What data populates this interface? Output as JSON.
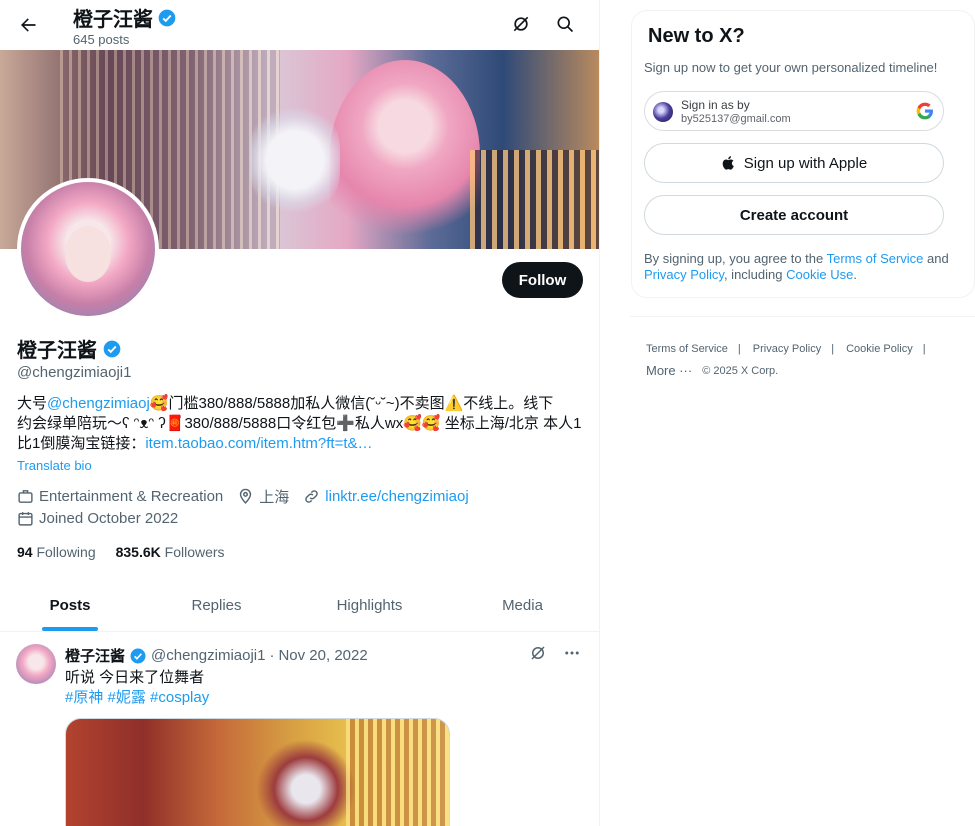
{
  "header": {
    "name": "橙子汪酱",
    "posts_count": "645 posts",
    "back_icon": "arrow-left-icon",
    "grok_icon": "grok-icon",
    "search_icon": "search-icon"
  },
  "profile": {
    "name": "橙子汪酱",
    "handle": "@chengzimiaoji1",
    "follow_label": "Follow",
    "bio": {
      "l1_a": "大号",
      "l1_mention": "@chengzimiaoj",
      "l1_b": "🥰门槛380/888/5888加私人微信(˘ᵕ˘~)不卖图⚠️不线上。线下",
      "l2": "约会绿单陪玩～ʕ ᵔᴥᵔ ʔ🧧380/888/5888口令红包➕私人wx🥰🥰 坐标上海/北京 本人1",
      "l3_a": "比1倒膜淘宝链接：",
      "l3_link": "item.taobao.com/item.htm?ft=t&…"
    },
    "translate_label": "Translate bio",
    "category": "Entertainment & Recreation",
    "location": "上海",
    "website": "linktr.ee/chengzimiaoj",
    "joined": "Joined October 2022",
    "following_count": "94",
    "following_label": "Following",
    "followers_count": "835.6K",
    "followers_label": "Followers"
  },
  "tabs": [
    {
      "label": "Posts",
      "active": true
    },
    {
      "label": "Replies",
      "active": false
    },
    {
      "label": "Highlights",
      "active": false
    },
    {
      "label": "Media",
      "active": false
    }
  ],
  "post": {
    "name": "橙子汪酱",
    "handle": "@chengzimiaoji1",
    "dot": "·",
    "date": "Nov 20, 2022",
    "text": "听说 今日来了位舞者",
    "tags": "#原神 #妮露 #cosplay"
  },
  "sidebar": {
    "title": "New to X?",
    "subtitle": "Sign up now to get your own personalized timeline!",
    "google_signin_label": "Sign in as by",
    "google_email": "by525137@gmail.com",
    "apple_label": "Sign up with Apple",
    "create_label": "Create account",
    "terms_a": "By signing up, you agree to the ",
    "terms_tos": "Terms of Service",
    "terms_b": " and ",
    "terms_pp": "Privacy Policy",
    "terms_c": ", including ",
    "terms_cu": "Cookie Use",
    "terms_d": "."
  },
  "footer": {
    "tos": "Terms of Service",
    "privacy": "Privacy Policy",
    "cookie": "Cookie Policy",
    "sep": "|",
    "more": "More ···",
    "copyright": "© 2025 X Corp."
  },
  "colors": {
    "accent": "#1d9bf0",
    "text": "#0f1419",
    "muted": "#536471"
  }
}
